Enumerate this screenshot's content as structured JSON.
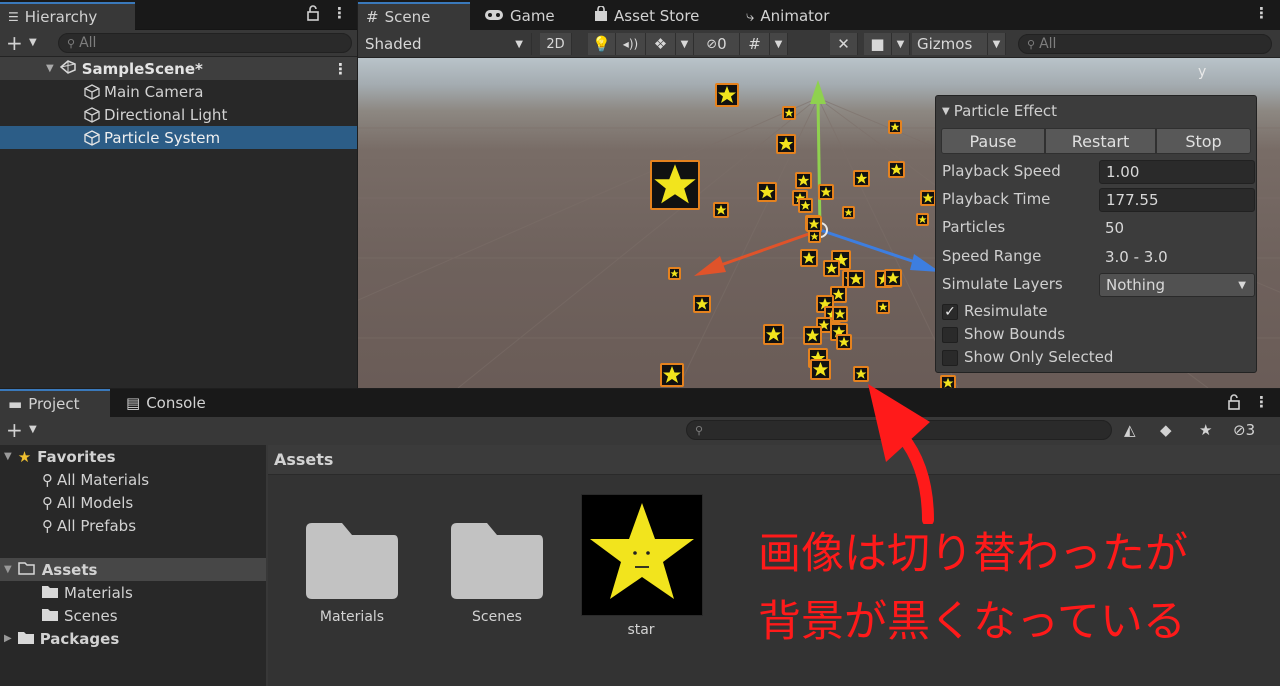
{
  "hierarchy": {
    "tab_label": "Hierarchy",
    "search_placeholder": "All",
    "scene_name": "SampleScene*",
    "items": [
      {
        "label": "Main Camera"
      },
      {
        "label": "Directional Light"
      },
      {
        "label": "Particle System"
      }
    ]
  },
  "scene_tabs": {
    "tabs": [
      {
        "label": "Scene"
      },
      {
        "label": "Game"
      },
      {
        "label": "Asset Store"
      },
      {
        "label": "Animator"
      }
    ],
    "shading_mode": "Shaded",
    "mode_2d": "2D",
    "hidden_count": "0",
    "gizmos_label": "Gizmos",
    "search_placeholder": "All",
    "axis_label_y": "y"
  },
  "particle_effect": {
    "title": "Particle Effect",
    "pause_label": "Pause",
    "restart_label": "Restart",
    "stop_label": "Stop",
    "playback_speed_label": "Playback Speed",
    "playback_speed_value": "1.00",
    "playback_time_label": "Playback Time",
    "playback_time_value": "177.55",
    "particles_label": "Particles",
    "particles_value": "50",
    "speed_range_label": "Speed Range",
    "speed_range_value": "3.0 - 3.0",
    "simulate_layers_label": "Simulate Layers",
    "simulate_layers_value": "Nothing",
    "resimulate_label": "Resimulate",
    "resimulate_checked": true,
    "show_bounds_label": "Show Bounds",
    "show_only_selected_label": "Show Only Selected"
  },
  "project": {
    "tabs": [
      {
        "label": "Project"
      },
      {
        "label": "Console"
      }
    ],
    "hidden_count": "3",
    "favorites_label": "Favorites",
    "favorites": [
      {
        "label": "All Materials"
      },
      {
        "label": "All Models"
      },
      {
        "label": "All Prefabs"
      }
    ],
    "assets_label": "Assets",
    "assets_children": [
      {
        "label": "Materials"
      },
      {
        "label": "Scenes"
      }
    ],
    "packages_label": "Packages",
    "breadcrumb": "Assets",
    "grid_items": [
      {
        "label": "Materials"
      },
      {
        "label": "Scenes"
      },
      {
        "label": "star"
      }
    ]
  },
  "annotation": {
    "line1": "画像は切り替わったが",
    "line2": "背景が黒くなっている",
    "color": "#ff1a1a"
  },
  "colors": {
    "selection": "#2c5d87",
    "particle_border": "#e5821e",
    "star_yellow": "#f2e41d"
  }
}
